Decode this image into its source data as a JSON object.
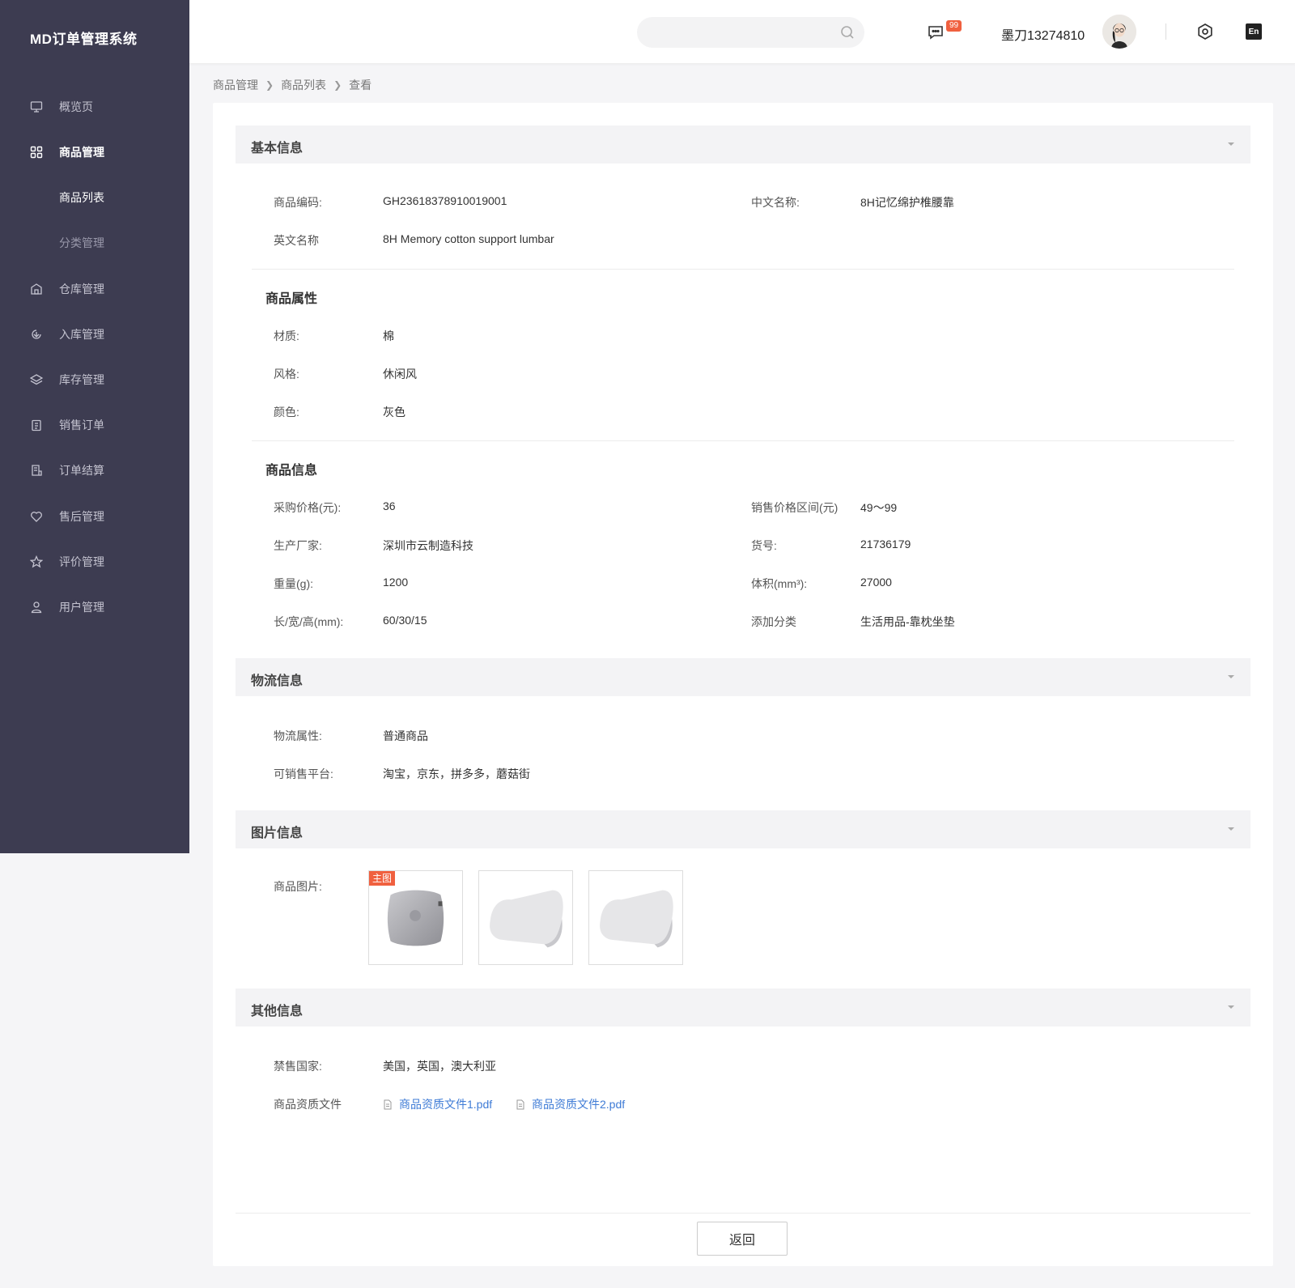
{
  "app": {
    "title": "MD订单管理系统"
  },
  "sidebar": {
    "items": [
      {
        "label": "概览页",
        "icon": "monitor-icon"
      },
      {
        "label": "商品管理",
        "icon": "grid-icon"
      },
      {
        "label": "商品列表"
      },
      {
        "label": "分类管理"
      },
      {
        "label": "仓库管理",
        "icon": "warehouse-icon"
      },
      {
        "label": "入库管理",
        "icon": "inbound-icon"
      },
      {
        "label": "库存管理",
        "icon": "layers-icon"
      },
      {
        "label": "销售订单",
        "icon": "clipboard-icon"
      },
      {
        "label": "订单结算",
        "icon": "settlement-icon"
      },
      {
        "label": "售后管理",
        "icon": "heart-icon"
      },
      {
        "label": "评价管理",
        "icon": "star-icon"
      },
      {
        "label": "用户管理",
        "icon": "user-icon"
      }
    ]
  },
  "header": {
    "search_placeholder": "",
    "badge": "99",
    "username": "墨刀13274810",
    "lang": "En"
  },
  "breadcrumb": [
    "商品管理",
    "商品列表",
    "查看"
  ],
  "sections": {
    "basic": {
      "title": "基本信息"
    },
    "logistics": {
      "title": "物流信息"
    },
    "images": {
      "title": "图片信息"
    },
    "other": {
      "title": "其他信息"
    }
  },
  "basic": {
    "code_label": "商品编码:",
    "code": "GH23618378910019001",
    "cn_label": "中文名称:",
    "cn_name": "8H记忆绵护椎腰靠",
    "en_label": "英文名称",
    "en_name": "8H Memory cotton support lumbar"
  },
  "attributes": {
    "title": "商品属性",
    "material_label": "材质:",
    "material": "棉",
    "style_label": "风格:",
    "style": "休闲风",
    "color_label": "颜色:",
    "color": "灰色"
  },
  "product_info": {
    "title": "商品信息",
    "purchase_price_label": "采购价格(元):",
    "purchase_price": "36",
    "sale_range_label": "销售价格区间(元)",
    "sale_range": "49～99",
    "maker_label": "生产厂家:",
    "maker": "深圳市云制造科技",
    "sku_label": "货号:",
    "sku": "21736179",
    "weight_label": "重量(g):",
    "weight": "1200",
    "volume_label": "体积(mm³):",
    "volume": "27000",
    "dims_label": "长/宽/高(mm):",
    "dims": "60/30/15",
    "category_label": "添加分类",
    "category": "生活用品-靠枕坐垫"
  },
  "logistics": {
    "attr_label": "物流属性:",
    "attr": "普通商品",
    "platform_label": "可销售平台:",
    "platforms": "淘宝，京东，拼多多，蘑菇街"
  },
  "images": {
    "label": "商品图片:",
    "main_tag": "主图"
  },
  "other": {
    "banned_label": "禁售国家:",
    "banned": "美国，英国，澳大利亚",
    "files_label": "商品资质文件",
    "file1": "商品资质文件1.pdf",
    "file2": "商品资质文件2.pdf"
  },
  "footer": {
    "back_label": "返回"
  },
  "colors": {
    "sidebar": "#3d3c51",
    "accent": "#f0603f",
    "link": "#3e7bd6"
  }
}
